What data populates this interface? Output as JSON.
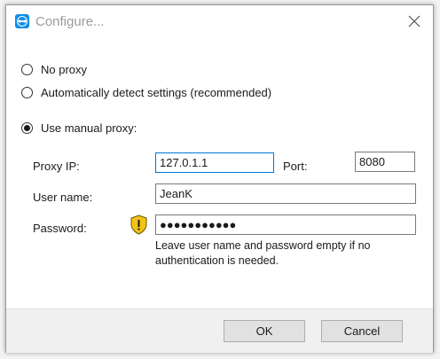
{
  "window": {
    "title": "Configure..."
  },
  "proxy_options": [
    {
      "label": "No proxy",
      "checked": false
    },
    {
      "label": "Automatically detect settings (recommended)",
      "checked": false
    },
    {
      "label": "Use manual proxy:",
      "checked": true
    }
  ],
  "form": {
    "proxy_ip_label": "Proxy IP:",
    "proxy_ip_value": "127.0.1.1",
    "port_label": "Port:",
    "port_value": "8080",
    "user_name_label": "User name:",
    "user_name_value": "JeanK",
    "password_label": "Password:",
    "password_value": "●●●●●●●●●●●",
    "hint": "Leave user name and password empty if no authentication is needed."
  },
  "buttons": {
    "ok": "OK",
    "cancel": "Cancel"
  },
  "icons": {
    "app": "teamviewer-icon",
    "close": "close-icon",
    "shield": "warning-shield-icon"
  },
  "colors": {
    "accent": "#0078d7",
    "shield_yellow": "#f2c318"
  }
}
